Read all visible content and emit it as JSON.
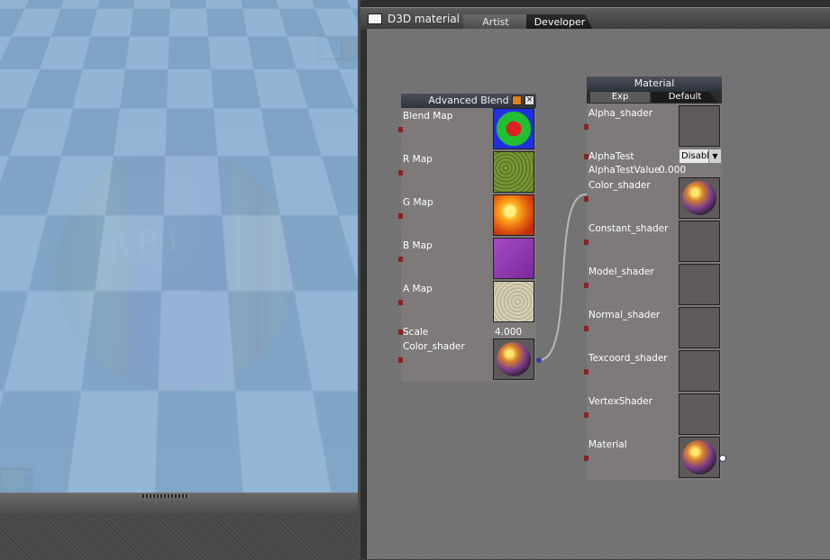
{
  "window": {
    "title": "D3D material",
    "tabs": [
      {
        "label": "Artist",
        "active": false
      },
      {
        "label": "Developer",
        "active": true
      }
    ]
  },
  "viewport": {
    "sphere_text": "RRI"
  },
  "advanced_blend": {
    "title": "Advanced Blend",
    "close": "×",
    "slots": [
      {
        "label": "Blend Map",
        "thumb": "blend-map-thumb"
      },
      {
        "label": "R Map",
        "thumb": "grass-texture"
      },
      {
        "label": "G Map",
        "thumb": "fire-texture"
      },
      {
        "label": "B Map",
        "thumb": "logo-texture"
      },
      {
        "label": "A Map",
        "thumb": "sand-texture"
      }
    ],
    "scale_label": "Scale",
    "scale_value": "4.000",
    "color_shader_label": "Color_shader"
  },
  "material": {
    "title": "Material",
    "subtabs": {
      "exp": "Exp",
      "default": "Default"
    },
    "alpha_shader": "Alpha_shader",
    "alpha_test": "AlphaTest",
    "alpha_test_value_selected": "Disabl",
    "alpha_test_value_label": "AlphaTestValue",
    "alpha_test_value": "0.000",
    "color_shader": "Color_shader",
    "constant_shader": "Constant_shader",
    "model_shader": "Model_shader",
    "normal_shader": "Normal_shader",
    "texcoord_shader": "Texcoord_shader",
    "vertex_shader": "VertexShader",
    "material": "Material"
  },
  "colors": {
    "node_body": "#7d7a79",
    "node_header": "#3a3f48",
    "pin": "#8b2222",
    "link": "#b8b8b8"
  }
}
